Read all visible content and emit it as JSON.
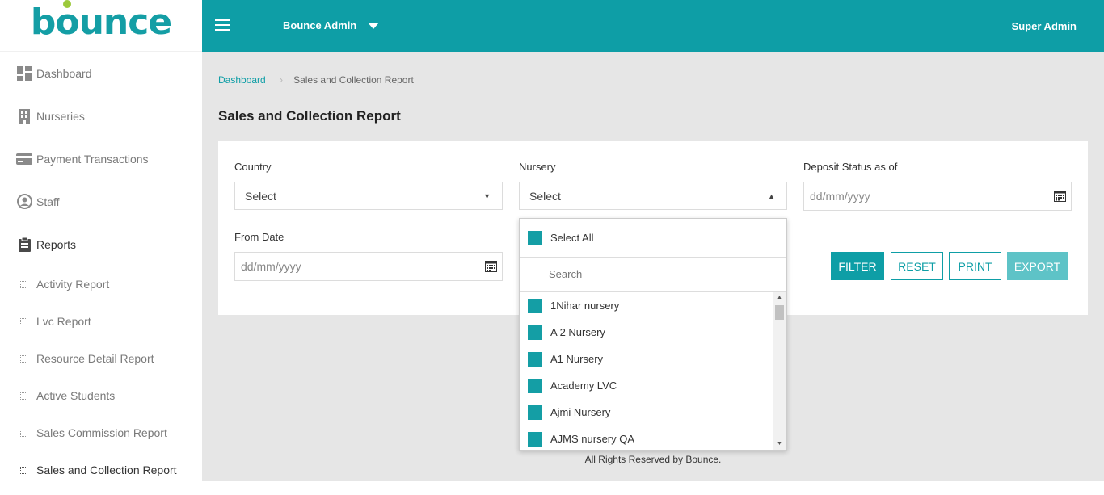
{
  "brand": {
    "logo_text": "bounce",
    "primary_color": "#0e9ea6",
    "accent_color": "#9cc93b"
  },
  "sidebar": {
    "items": [
      {
        "label": "Dashboard",
        "icon": "dashboard-icon"
      },
      {
        "label": "Nurseries",
        "icon": "building-icon"
      },
      {
        "label": "Payment Transactions",
        "icon": "credit-card-icon"
      },
      {
        "label": "Staff",
        "icon": "user-circle-icon"
      },
      {
        "label": "Reports",
        "icon": "clipboard-icon"
      }
    ],
    "reports_sub": [
      {
        "label": "Activity Report"
      },
      {
        "label": "Lvc Report"
      },
      {
        "label": "Resource Detail Report"
      },
      {
        "label": "Active Students"
      },
      {
        "label": "Sales Commission Report"
      },
      {
        "label": "Sales and Collection Report"
      }
    ]
  },
  "header": {
    "title": "Bounce Admin",
    "user": "Super Admin"
  },
  "breadcrumb": {
    "home": "Dashboard",
    "current": "Sales and Collection Report"
  },
  "page": {
    "title": "Sales and Collection Report"
  },
  "filters": {
    "country": {
      "label": "Country",
      "value": "Select"
    },
    "nursery": {
      "label": "Nursery",
      "value": "Select"
    },
    "deposit": {
      "label": "Deposit Status as of",
      "placeholder": "dd/mm/yyyy"
    },
    "from_date": {
      "label": "From Date",
      "placeholder": "dd/mm/yyyy"
    }
  },
  "buttons": {
    "filter": "FILTER",
    "reset": "RESET",
    "print": "PRINT",
    "export": "EXPORT"
  },
  "dropdown": {
    "select_all": "Select All",
    "search_placeholder": "Search",
    "options": [
      "1Nihar nursery",
      "A 2 Nursery",
      "A1 Nursery",
      "Academy LVC",
      "Ajmi Nursery",
      "AJMS nursery QA"
    ]
  },
  "footer": {
    "text": "All Rights Reserved by Bounce."
  }
}
